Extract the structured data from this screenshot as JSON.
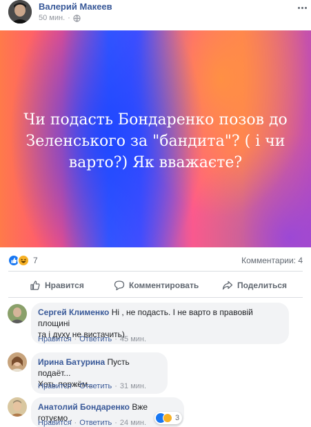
{
  "post": {
    "author": "Валерий Макеев",
    "time": "50 мин.",
    "privacy_icon": "globe-icon",
    "banner_text": "Чи подасть Бондаренко позов до Зеленського за \"бандита\"? ( і чи варто?) Як вважаєте?",
    "banner_colors": [
      "#ff7a4a",
      "#ff4d7f",
      "#3a5bff",
      "#c24fb0"
    ]
  },
  "reactions": {
    "icons": [
      "like-icon",
      "haha-icon"
    ],
    "count": "7",
    "comments_label": "Комментарии: 4"
  },
  "actions": {
    "like": "Нравится",
    "comment": "Комментировать",
    "share": "Поделиться"
  },
  "comments": [
    {
      "author": "Сергей Клименко",
      "text_line1": " Ні , не подасть. І не варто в правовій площині",
      "text_line2": "та і духу не вистачить)",
      "like": "Нравится",
      "reply": "Ответить",
      "time": "45 мин."
    },
    {
      "author": "Ирина Батурина",
      "text_line1": " Пусть подаёт...",
      "text_line2": "Хоть поржём...",
      "like": "Нравится",
      "reply": "Ответить",
      "time": "31 мин."
    },
    {
      "author": "Анатолий Бондаренко",
      "text_line1": " Вже готуємо .",
      "like": "Нравится",
      "reply": "Ответить",
      "time": "24 мин.",
      "reactions_count": "3"
    }
  ]
}
